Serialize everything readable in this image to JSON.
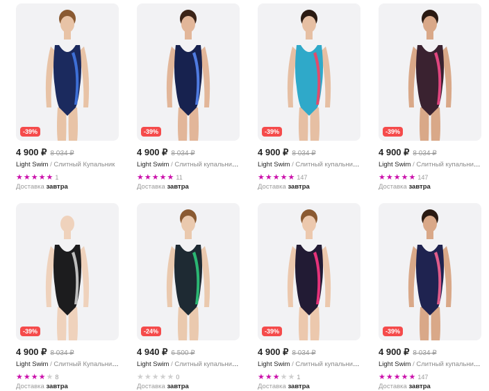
{
  "products": [
    {
      "discount": "-39%",
      "price": "4 900 ₽",
      "old_price": "8 034 ₽",
      "brand": "Light Swim",
      "separator": " / ",
      "name": "Слитный Купальник",
      "stars": 5,
      "reviews": "1",
      "delivery_label": "Доставка",
      "delivery_value": "завтра",
      "suit_color": "#1b2a5e",
      "accent": "#3d6fd6",
      "skin": "#e8c3a6",
      "hair": "#8a5a32"
    },
    {
      "discount": "-39%",
      "price": "4 900 ₽",
      "old_price": "8 034 ₽",
      "brand": "Light Swim",
      "separator": " / ",
      "name": "Слитный купальник же...",
      "stars": 5,
      "reviews": "11",
      "delivery_label": "Доставка",
      "delivery_value": "завтра",
      "suit_color": "#17224f",
      "accent": "#4f7be0",
      "skin": "#e2b699",
      "hair": "#3b2418"
    },
    {
      "discount": "-39%",
      "price": "4 900 ₽",
      "old_price": "8 034 ₽",
      "brand": "Light Swim",
      "separator": " / ",
      "name": "Слитный купальник же...",
      "stars": 5,
      "reviews": "147",
      "delivery_label": "Доставка",
      "delivery_value": "завтра",
      "suit_color": "#2fa9c9",
      "accent": "#e04c6c",
      "skin": "#e6bfa3",
      "hair": "#2a1a12"
    },
    {
      "discount": "-39%",
      "price": "4 900 ₽",
      "old_price": "8 034 ₽",
      "brand": "Light Swim",
      "separator": " / ",
      "name": "Слитный купальник же...",
      "stars": 5,
      "reviews": "147",
      "delivery_label": "Доставка",
      "delivery_value": "завтра",
      "suit_color": "#3a2230",
      "accent": "#e0467f",
      "skin": "#d9a888",
      "hair": "#2a1a12"
    },
    {
      "discount": "-39%",
      "price": "4 900 ₽",
      "old_price": "8 034 ₽",
      "brand": "Light Swim",
      "separator": " / ",
      "name": "Слитный Купальник же...",
      "stars": 4,
      "reviews": "8",
      "delivery_label": "Доставка",
      "delivery_value": "завтра",
      "suit_color": "#1c1c1e",
      "accent": "#bdbdbd",
      "skin": "#efd2bc",
      "hair": "#f2f2f4"
    },
    {
      "discount": "-24%",
      "price": "4 940 ₽",
      "old_price": "6 500 ₽",
      "brand": "Light Swim",
      "separator": " / ",
      "name": "Слитный купальник же...",
      "stars": 0,
      "reviews": "0",
      "delivery_label": "Доставка",
      "delivery_value": "завтра",
      "suit_color": "#1e2a33",
      "accent": "#2bb673",
      "skin": "#eac9ae",
      "hair": "#8a5a32"
    },
    {
      "discount": "-39%",
      "price": "4 900 ₽",
      "old_price": "8 034 ₽",
      "brand": "Light Swim",
      "separator": " / ",
      "name": "Слитный купальник же...",
      "stars": 3,
      "reviews": "1",
      "delivery_label": "Доставка",
      "delivery_value": "завтра",
      "suit_color": "#221b34",
      "accent": "#e6337a",
      "skin": "#ecc8ad",
      "hair": "#8a5a32"
    },
    {
      "discount": "-39%",
      "price": "4 900 ₽",
      "old_price": "8 034 ₽",
      "brand": "Light Swim",
      "separator": " / ",
      "name": "Слитный купальник же...",
      "stars": 5,
      "reviews": "147",
      "delivery_label": "Доставка",
      "delivery_value": "завтра",
      "suit_color": "#1f2350",
      "accent": "#e05c8a",
      "skin": "#d9a888",
      "hair": "#2a1a12"
    }
  ]
}
